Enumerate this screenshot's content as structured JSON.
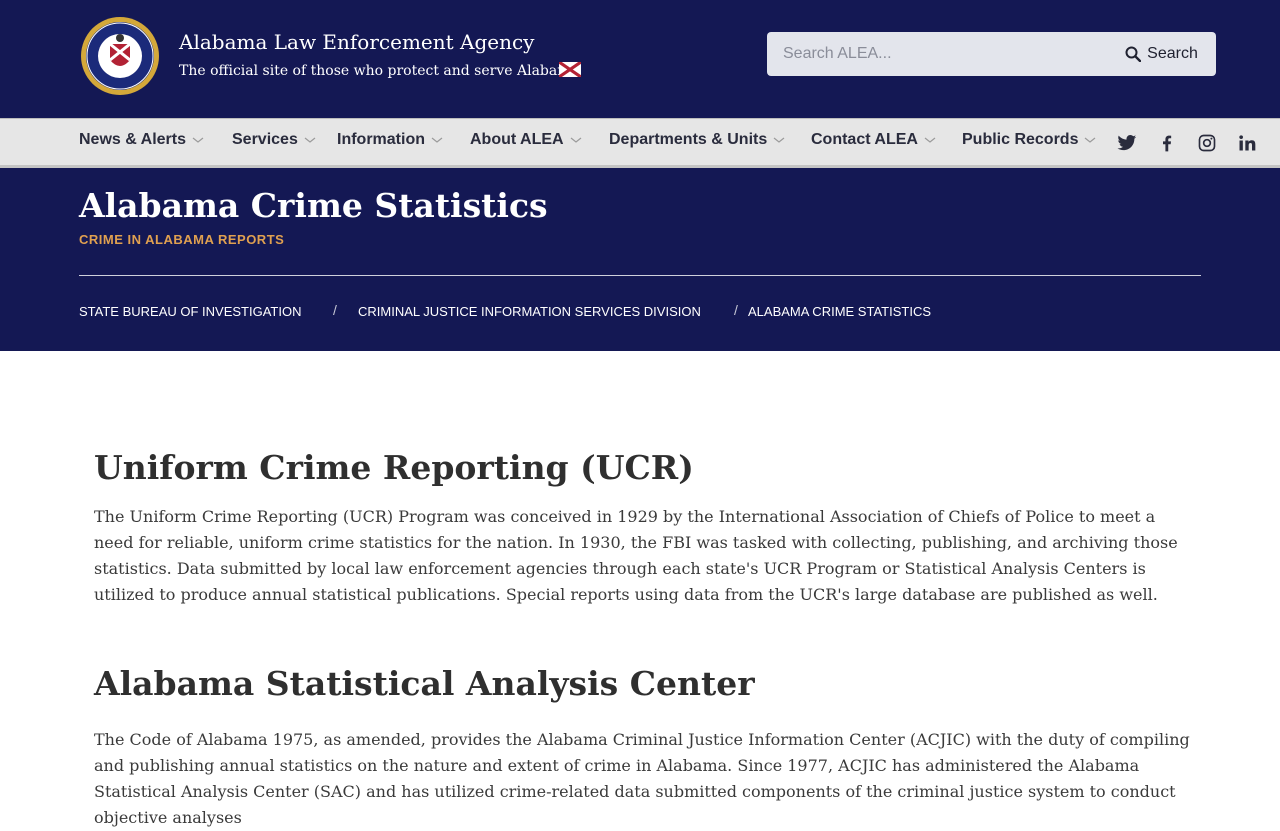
{
  "header": {
    "agency_name": "Alabama Law Enforcement Agency",
    "tagline": "The official site of those who protect and serve Alabama",
    "search_placeholder": "Search ALEA...",
    "search_button": "Search"
  },
  "nav": {
    "items": [
      {
        "label": "News & Alerts"
      },
      {
        "label": "Services"
      },
      {
        "label": "Information"
      },
      {
        "label": "About ALEA"
      },
      {
        "label": "Departments & Units"
      },
      {
        "label": "Contact ALEA"
      },
      {
        "label": "Public Records"
      }
    ],
    "social": [
      "twitter-icon",
      "facebook-icon",
      "instagram-icon",
      "linkedin-icon"
    ]
  },
  "page": {
    "title": "Alabama Crime Statistics",
    "subtitle": "CRIME IN ALABAMA REPORTS",
    "breadcrumb": [
      {
        "label": "STATE BUREAU OF INVESTIGATION"
      },
      {
        "label": "CRIMINAL JUSTICE INFORMATION SERVICES DIVISION"
      },
      {
        "label": "ALABAMA CRIME STATISTICS"
      }
    ]
  },
  "content": {
    "sections": [
      {
        "heading": "Uniform Crime Reporting (UCR)",
        "body": "The Uniform Crime Reporting (UCR) Program was conceived in 1929 by the International Association of Chiefs of Police to meet a need for reliable, uniform crime statistics for the nation. In 1930, the FBI was tasked with collecting, publishing, and archiving those statistics. Data submitted by local law enforcement agencies through each state's UCR Program or Statistical Analysis Centers is utilized to produce annual statistical publications. Special reports using data from the UCR's large database are published as well."
      },
      {
        "heading": "Alabama Statistical Analysis Center",
        "body": "The Code of Alabama 1975, as amended, provides the Alabama Criminal Justice Information Center (ACJIC) with the duty of compiling and publishing annual statistics on the nature and extent of crime in Alabama. Since 1977, ACJIC has administered the Alabama Statistical Analysis Center (SAC) and has utilized crime-related data submitted components of the criminal justice system to conduct objective analyses"
      }
    ]
  },
  "colors": {
    "navy": "#141854",
    "nav_bg": "#e6e6e6",
    "accent_orange": "#e0a050"
  }
}
